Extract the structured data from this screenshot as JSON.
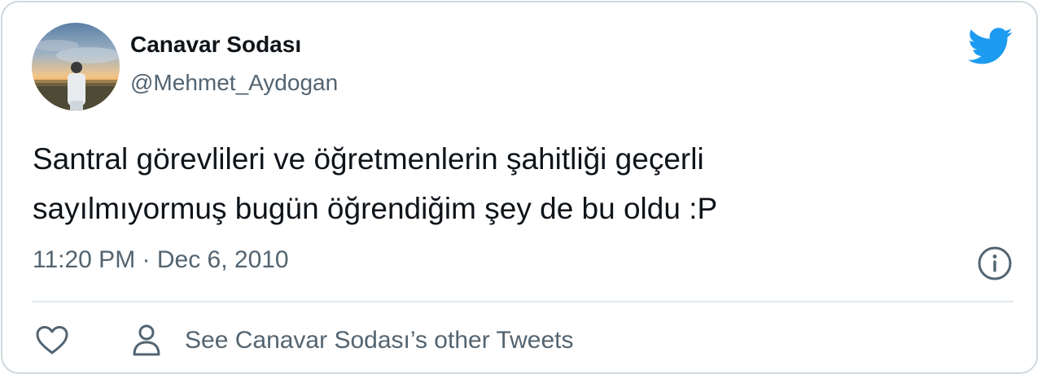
{
  "tweet": {
    "author": {
      "display_name": "Canavar Sodası",
      "handle": "@Mehmet_Aydogan",
      "avatar_icon": "profile-photo"
    },
    "brand_icon": "twitter-bird-icon",
    "text_lines": [
      "Santral görevlileri ve öğretmenlerin şahitliği geçerli",
      "sayılmıyormuş bugün öğrendiğim şey de bu oldu :P"
    ],
    "timestamp": "11:20 PM · Dec 6, 2010",
    "info_icon": "info-icon",
    "actions": {
      "like_icon": "heart-icon",
      "see_more_icon": "person-icon",
      "see_more_label": "See Canavar Sodası’s other Tweets"
    }
  },
  "colors": {
    "primary_text": "#0f1419",
    "secondary_text": "#536471",
    "brand_blue": "#1d9bf0",
    "border": "#cfd9de",
    "divider": "#e1e8ed"
  }
}
